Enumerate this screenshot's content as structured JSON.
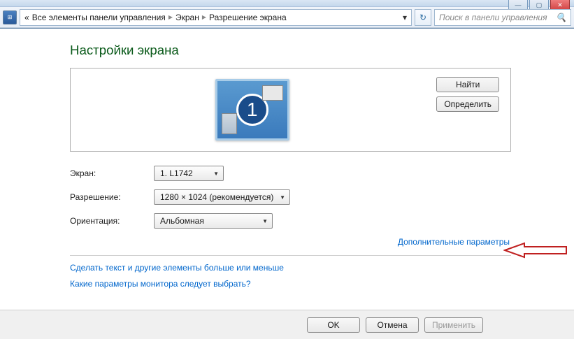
{
  "window": {
    "minimize": "—",
    "maximize": "▢",
    "close": "✕"
  },
  "breadcrumb": {
    "back_chevrons": "«",
    "item1": "Все элементы панели управления",
    "item2": "Экран",
    "item3": "Разрешение экрана",
    "refresh": "↻",
    "search_placeholder": "Поиск в панели управления"
  },
  "page": {
    "heading": "Настройки экрана",
    "monitor_number": "1",
    "detect_button": "Найти",
    "identify_button": "Определить"
  },
  "form": {
    "display_label": "Экран:",
    "display_value": "1. L1742",
    "resolution_label": "Разрешение:",
    "resolution_value": "1280 × 1024 (рекомендуется)",
    "orientation_label": "Ориентация:",
    "orientation_value": "Альбомная"
  },
  "links": {
    "advanced": "Дополнительные параметры",
    "text_size": "Сделать текст и другие элементы больше или меньше",
    "which_monitor": "Какие параметры монитора следует выбрать?"
  },
  "buttons": {
    "ok": "OK",
    "cancel": "Отмена",
    "apply": "Применить"
  }
}
